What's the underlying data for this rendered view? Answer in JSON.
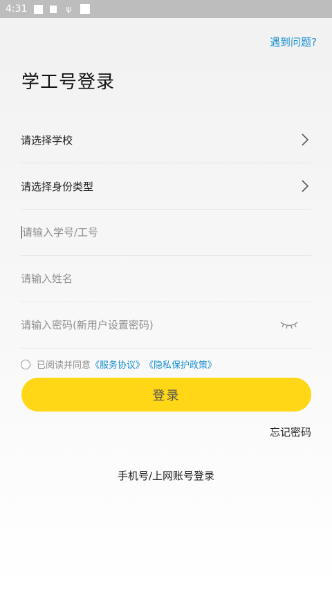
{
  "status_bar": {
    "time": "4:31"
  },
  "header": {
    "help_link": "遇到问题?",
    "title": "学工号登录"
  },
  "form": {
    "school_label": "请选择学校",
    "identity_label": "请选择身份类型",
    "student_id_placeholder": "请输入学号/工号",
    "name_placeholder": "请输入姓名",
    "password_placeholder": "请输入密码(新用户设置密码)"
  },
  "agreement": {
    "prefix": "已阅读并同意",
    "service_link": "《服务协议》",
    "privacy_link": "《隐私保护政策》",
    "checked": false
  },
  "actions": {
    "login_label": "登录",
    "forgot_label": "忘记密码",
    "alt_login_label": "手机号/上网账号登录"
  },
  "colors": {
    "accent_button": "#ffd716",
    "link": "#1a8fd1"
  },
  "icons": [
    "chevron-right-icon",
    "eye-closed-icon",
    "radio-unchecked-icon"
  ]
}
